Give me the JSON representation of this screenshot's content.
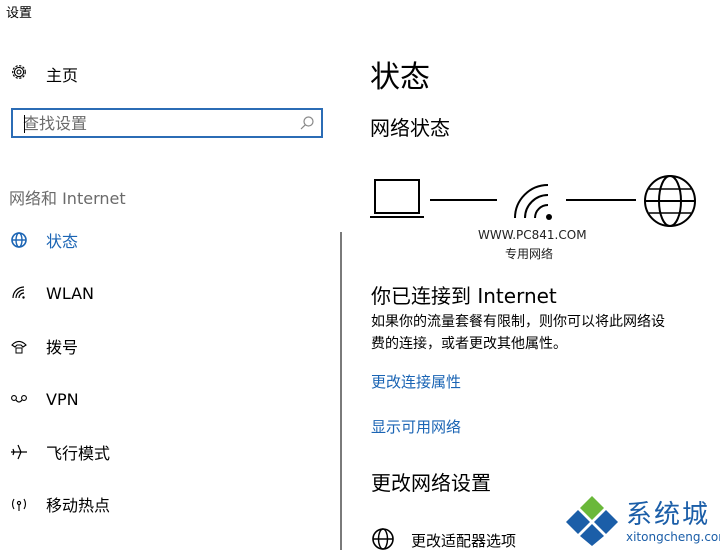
{
  "window": {
    "title": "设置"
  },
  "sidebar": {
    "home_label": "主页",
    "search": {
      "placeholder": "查找设置"
    },
    "section_title": "网络和 Internet",
    "items": [
      {
        "label": "状态",
        "icon": "globe-icon",
        "active": true
      },
      {
        "label": "WLAN",
        "icon": "wifi-icon"
      },
      {
        "label": "拨号",
        "icon": "phone-icon"
      },
      {
        "label": "VPN",
        "icon": "vpn-icon"
      },
      {
        "label": "飞行模式",
        "icon": "airplane-icon"
      },
      {
        "label": "移动热点",
        "icon": "hotspot-icon"
      }
    ]
  },
  "main": {
    "title": "状态",
    "network_status_heading": "网络状态",
    "watermark_url": "WWW.PC841.COM",
    "network_type": "专用网络",
    "connected_title": "你已连接到 Internet",
    "connected_desc_line1": "如果你的流量套餐有限制，则你可以将此网络设",
    "connected_desc_line2": "费的连接，或者更改其他属性。",
    "link_change_props": "更改连接属性",
    "link_show_networks": "显示可用网络",
    "change_settings_heading": "更改网络设置",
    "adapter_options": "更改适配器选项"
  },
  "logo": {
    "brand": "系统城",
    "url": "xitongcheng.com"
  },
  "colors": {
    "accent": "#1a64b4",
    "search_border": "#2b6cb5",
    "logo_blue": "#1b5ea8",
    "logo_green": "#6ab83a"
  }
}
